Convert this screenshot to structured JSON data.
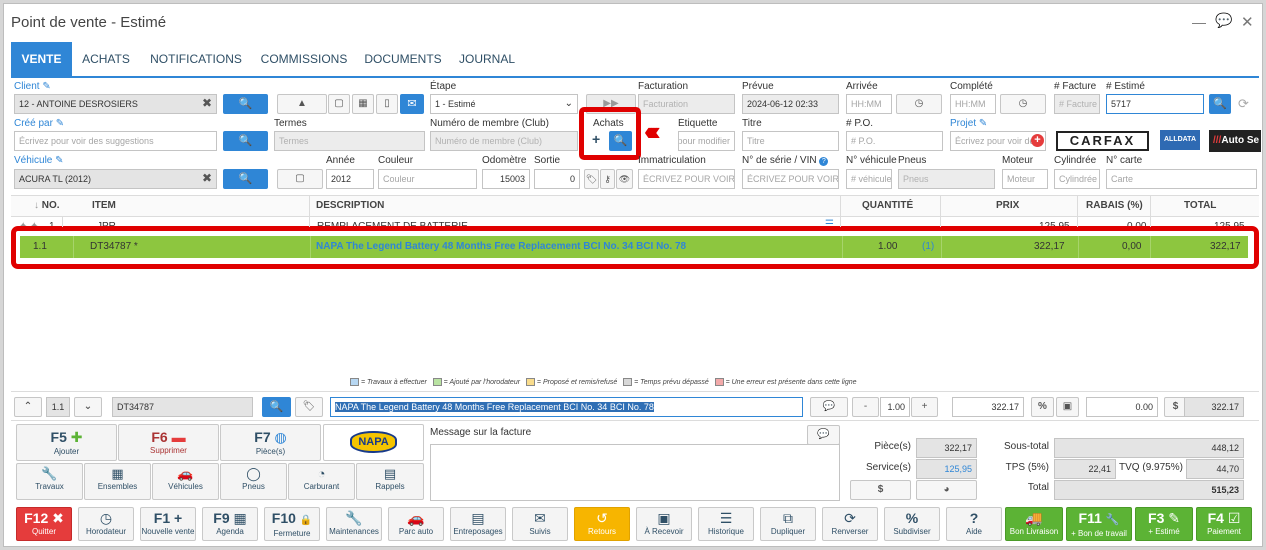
{
  "window": {
    "title": "Point de vente - Estimé"
  },
  "tabs": [
    "VENTE",
    "ACHATS",
    "NOTIFICATIONS",
    "COMMISSIONS",
    "DOCUMENTS",
    "JOURNAL"
  ],
  "header": {
    "client_label": "Client",
    "client_value": "12 - ANTOINE DESROSIERS",
    "etape_label": "Étape",
    "etape_value": "1 - Estimé",
    "facturation_label": "Facturation",
    "facturation_placeholder": "Facturation",
    "prevue_label": "Prévue",
    "prevue_value": "2024-06-12 02:33",
    "arrivee_label": "Arrivée",
    "arrivee_placeholder": "HH:MM",
    "complete_label": "Complété",
    "complete_placeholder": "HH:MM",
    "facture_label": "# Facture",
    "facture_placeholder": "# Facture",
    "estime_label": "# Estimé",
    "estime_value": "5717",
    "cree_label": "Créé par",
    "cree_placeholder": "Écrivez pour voir des suggestions",
    "termes_label": "Termes",
    "termes_placeholder": "Termes",
    "membre_label": "Numéro de membre (Club)",
    "membre_placeholder": "Numéro de membre (Club)",
    "achats_label": "Achats",
    "etiquette_label": "Étiquette",
    "etiquette_placeholder": "Cliquez pour modifier",
    "titre_label": "Titre",
    "titre_placeholder": "Titre",
    "po_label": "# P.O.",
    "po_placeholder": "# P.O.",
    "projet_label": "Projet",
    "projet_placeholder": "Écrivez pour voir des",
    "carfax": "CARFAX",
    "alldata": "ALLDATA",
    "autoserv": "Auto Se",
    "vehicule_label": "Véhicule",
    "vehicule_value": "ACURA TL (2012)",
    "annee_label": "Année",
    "annee_value": "2012",
    "couleur_label": "Couleur",
    "couleur_placeholder": "Couleur",
    "odometre_label": "Odomètre",
    "odometre_value": "15003",
    "sortie_label": "Sortie",
    "sortie_value": "0",
    "immat_label": "Immatriculation",
    "immat_placeholder": "ÉCRIVEZ POUR VOIR D",
    "vin_label": "N° de série / VIN",
    "vin_placeholder": "ÉCRIVEZ POUR VOIR DE",
    "nveh_label": "N° véhicule",
    "nveh_placeholder": "# véhicule",
    "pneus_label": "Pneus",
    "pneus_placeholder": "Pneus",
    "moteur_label": "Moteur",
    "moteur_placeholder": "Moteur",
    "cylindree_label": "Cylindrée",
    "cylindree_placeholder": "Cylindrée",
    "carte_label": "N° carte",
    "carte_placeholder": "Carte"
  },
  "table": {
    "columns": [
      "NO.",
      "ITEM",
      "DESCRIPTION",
      "QUANTITÉ",
      "PRIX",
      "RABAIS (%)",
      "TOTAL"
    ],
    "rows": [
      {
        "no": "1",
        "item": "JPR",
        "description": "REMPLACEMENT DE BATTERIE",
        "qty": "",
        "prix": "125,95",
        "rabais": "0,00",
        "total": "125,95"
      },
      {
        "no": "1.1",
        "item": "DT34787 *",
        "description": "NAPA The Legend Battery 48 Months Free Replacement BCI No. 34 BCI No. 78",
        "qty": "1.00",
        "qty_badge": "(1)",
        "prix": "322,17",
        "rabais": "0,00",
        "total": "322,17"
      }
    ]
  },
  "legend": [
    "= Travaux à effectuer",
    "= Ajouté par l'horodateur",
    "= Proposé et remis/refusé",
    "= Temps prévu dépassé",
    "= Une erreur est présente dans cette ligne"
  ],
  "legend_colors": [
    "#b7d7f2",
    "#b9e3a2",
    "#f9dc8c",
    "#d8d8d8",
    "#f2a9a9"
  ],
  "editor": {
    "line": "1.1",
    "item": "DT34787",
    "description": "NAPA The Legend Battery 48 Months Free Replacement  BCI No. 34 BCI No. 78",
    "qty": "1.00",
    "prix": "322.17",
    "rabais": "0.00",
    "total": "322.17",
    "minus": "-",
    "plus": "+",
    "pct": "%"
  },
  "fkeys": [
    {
      "k": "F5",
      "t": "Ajouter"
    },
    {
      "k": "F6",
      "t": "Supprimer"
    },
    {
      "k": "F7",
      "t": "Pièce(s)"
    },
    {
      "k": "NAPA",
      "t": ""
    }
  ],
  "shortcuts": [
    "Travaux",
    "Ensembles",
    "Véhicules",
    "Pneus",
    "Carburant",
    "Rappels"
  ],
  "message_label": "Message sur la facture",
  "totals": {
    "pieces_label": "Pièce(s)",
    "pieces": "322,17",
    "service_label": "Service(s)",
    "service": "125,95",
    "dollar": "$",
    "soustotal_label": "Sous-total",
    "soustotal": "448,12",
    "tps_label": "TPS (5%)",
    "tps": "22,41",
    "tvq_label": "TVQ (9.975%)",
    "tvq": "44,70",
    "total_label": "Total",
    "total": "515,23"
  },
  "bottom": [
    {
      "k": "F12",
      "t": "Quitter",
      "style": "red",
      "icon": "✖"
    },
    {
      "k": "",
      "t": "Horodateur",
      "icon": "◷"
    },
    {
      "k": "F1",
      "t": "Nouvelle vente",
      "icon": "+"
    },
    {
      "k": "F9",
      "t": "Agenda",
      "icon": "▦"
    },
    {
      "k": "F10",
      "t": "Fermeture",
      "icon": "🔒"
    },
    {
      "k": "",
      "t": "Maintenances",
      "icon": "🔧"
    },
    {
      "k": "",
      "t": "Parc auto",
      "icon": "🚗"
    },
    {
      "k": "",
      "t": "Entreposages",
      "icon": "▤"
    },
    {
      "k": "",
      "t": "Suivis",
      "icon": "✉"
    },
    {
      "k": "",
      "t": "Retours",
      "style": "org",
      "icon": "↺"
    },
    {
      "k": "",
      "t": "À Recevoir",
      "icon": "▣"
    },
    {
      "k": "",
      "t": "Historique",
      "icon": "☰"
    },
    {
      "k": "",
      "t": "Dupliquer",
      "icon": "⧉"
    },
    {
      "k": "",
      "t": "Renverser",
      "icon": "⟳"
    },
    {
      "k": "",
      "t": "Subdiviser",
      "icon": "%"
    },
    {
      "k": "",
      "t": "Aide",
      "icon": "?"
    },
    {
      "k": "",
      "t": "Bon Livraison",
      "style": "grn",
      "icon": "🚚"
    },
    {
      "k": "F11",
      "t": "+ Bon de travail",
      "style": "grn",
      "icon": "🔧"
    },
    {
      "k": "F3",
      "t": "+ Estimé",
      "style": "grn",
      "icon": "✎"
    },
    {
      "k": "F4",
      "t": "Paiement",
      "style": "grn",
      "icon": "☑"
    }
  ],
  "colors": {
    "accent": "#2f86d6",
    "row_green": "#8dc63f",
    "highlight_red": "#e00000"
  }
}
